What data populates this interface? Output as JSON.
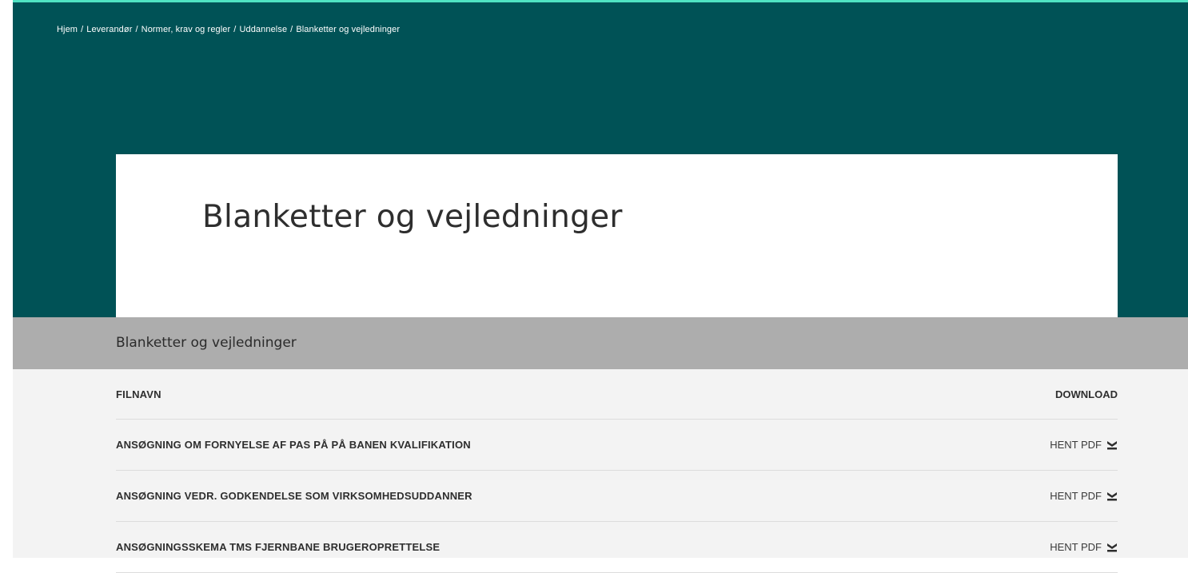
{
  "breadcrumb": {
    "items": [
      "Hjem",
      "Leverandør",
      "Normer, krav og regler",
      "Uddannelse",
      "Blanketter og vejledninger"
    ],
    "separator": "/"
  },
  "page": {
    "title": "Blanketter og vejledninger"
  },
  "section": {
    "title": "Blanketter og vejledninger"
  },
  "table": {
    "headers": {
      "name": "FILNAVN",
      "download": "DOWNLOAD"
    },
    "rows": [
      {
        "name": "ANSØGNING OM FORNYELSE AF PAS PÅ PÅ BANEN KVALIFIKATION",
        "link": "HENT PDF",
        "icon": "download-icon"
      },
      {
        "name": "ANSØGNING VEDR. GODKENDELSE SOM VIRKSOMHEDSUDDANNER",
        "link": "HENT PDF",
        "icon": "download-icon"
      },
      {
        "name": "ANSØGNINGSSKEMA TMS FJERNBANE BRUGEROPRETTELSE",
        "link": "HENT PDF",
        "icon": "download-icon"
      }
    ]
  },
  "colors": {
    "hero": "#005256",
    "accent": "#4fe3c3",
    "section_bar": "#adadad",
    "table_bg": "#f3f3f3"
  }
}
